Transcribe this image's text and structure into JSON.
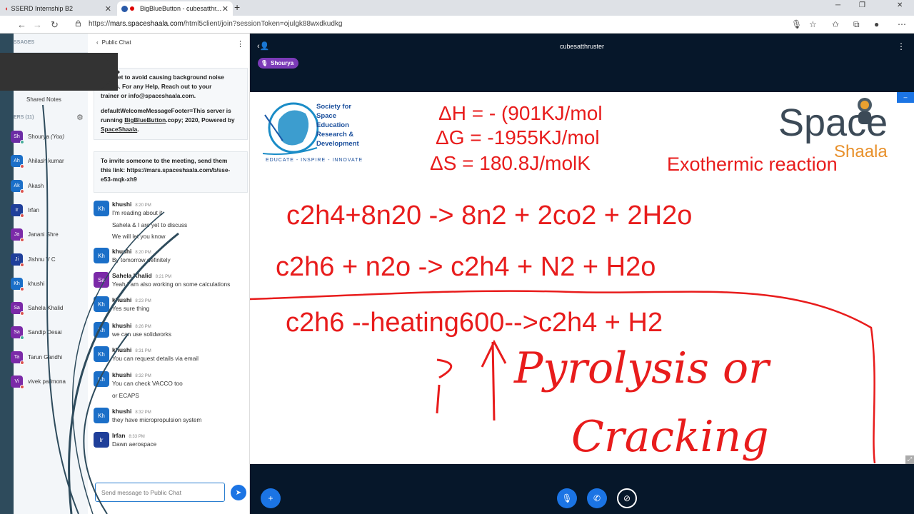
{
  "browser": {
    "tabs": [
      {
        "label": "SSERD Internship B2",
        "close": "✕"
      },
      {
        "label": "BigBlueButton - cubesatthr...",
        "close": "✕"
      }
    ],
    "new_tab": "+",
    "url_prefix": "https://",
    "url_domain": "mars.spaceshaala.com",
    "url_path": "/html5client/join?sessionToken=ojulgk88wxdkudkg"
  },
  "sidebar": {
    "messages_label": "SSAGES",
    "shared_notes": "Shared Notes",
    "users_label": "ERS (11)",
    "users": [
      {
        "initials": "Sh",
        "name": "Shourya",
        "suffix": "(You)",
        "color": "#6c2ca5",
        "status": "green"
      },
      {
        "initials": "Ah",
        "name": "Ahilash kumar",
        "color": "#1b6fc8",
        "status": "red"
      },
      {
        "initials": "Ak",
        "name": "Akash",
        "color": "#1b6fc8",
        "status": "red"
      },
      {
        "initials": "Ir",
        "name": "Irfan",
        "color": "#1f3f9a",
        "status": "red"
      },
      {
        "initials": "Ja",
        "name": "Janani Shre",
        "color": "#7b2aa8",
        "status": "red"
      },
      {
        "initials": "Ji",
        "name": "Jishnu V C",
        "color": "#1f3f9a",
        "status": "red"
      },
      {
        "initials": "Kh",
        "name": "khushi",
        "color": "#1b6fc8",
        "status": "red"
      },
      {
        "initials": "Sa",
        "name": "Sahela Khalid",
        "color": "#7b2aa8",
        "status": "red"
      },
      {
        "initials": "Sa",
        "name": "Sandip Desai",
        "color": "#7b2aa8",
        "status": "green"
      },
      {
        "initials": "Ta",
        "name": "Tarun Gandhi",
        "color": "#7b2aa8",
        "status": "red"
      },
      {
        "initials": "Vi",
        "name": "vivek pallmona",
        "color": "#7b2aa8",
        "status": "red"
      }
    ]
  },
  "chat": {
    "title": "Public Chat",
    "welcome": {
      "line1": "headset to avoid causing background noise",
      "line2": "others. For any Help, Reach out to your",
      "line3": "trainer or info@spaceshaala.com.",
      "footer1": "defaultWelcomeMessageFooter=This server is",
      "footer2a": "running ",
      "footer2_link": "BigBlueButton",
      "footer2b": ".copy; 2020, Powered by",
      "footer3_link": "SpaceShaala",
      "footer3b": "."
    },
    "invite": {
      "line1": "To invite someone to the meeting, send them",
      "line2": "this link: https://mars.spaceshaala.com/b/sse-",
      "line3": "e53-mqk-xh9"
    },
    "messages": [
      {
        "initials": "Kh",
        "color": "#1b6fc8",
        "name": "khushi",
        "time": "8:20 PM",
        "lines": [
          "I'm reading about it",
          "Sahela & I are yet to discuss",
          "We will let you know"
        ]
      },
      {
        "initials": "Kh",
        "color": "#1b6fc8",
        "name": "khushi",
        "time": "8:20 PM",
        "lines": [
          "By tomorrow definitely"
        ]
      },
      {
        "initials": "Sa",
        "color": "#7b2aa8",
        "name": "Sahela Khalid",
        "time": "8:21 PM",
        "lines": [
          "Yeah I am also working on some calculations"
        ]
      },
      {
        "initials": "Kh",
        "color": "#1b6fc8",
        "name": "khushi",
        "time": "8:23 PM",
        "lines": [
          "Yes sure thing"
        ]
      },
      {
        "initials": "Kh",
        "color": "#1b6fc8",
        "name": "khushi",
        "time": "8:26 PM",
        "lines": [
          "we can use solidworks"
        ]
      },
      {
        "initials": "Kh",
        "color": "#1b6fc8",
        "name": "khushi",
        "time": "8:31 PM",
        "lines": [
          "You can request details via email"
        ]
      },
      {
        "initials": "Kh",
        "color": "#1b6fc8",
        "name": "khushi",
        "time": "8:32 PM",
        "lines": [
          "You can check VACCO too",
          "or ECAPS"
        ]
      },
      {
        "initials": "Kh",
        "color": "#1b6fc8",
        "name": "khushi",
        "time": "8:32 PM",
        "lines": [
          "they have micropropulsion system"
        ]
      },
      {
        "initials": "Ir",
        "color": "#1f3f9a",
        "name": "Irfan",
        "time": "8:33 PM",
        "lines": [
          "Dawn aerospace"
        ]
      }
    ],
    "input_placeholder": "Send message to Public Chat"
  },
  "main": {
    "room_title": "cubesatthruster",
    "presenter": "Shourya",
    "slide": {
      "logo_lines": [
        "Society for",
        "Space",
        "Education",
        "Research &",
        "Development"
      ],
      "logo_tagline": "EDUCATE - INSPIRE - INNOVATE",
      "brand_top": "Space",
      "brand_bottom": "Shaala",
      "dh": "ΔH = - (901KJ/mol",
      "dg": "ΔG = -1955KJ/mol",
      "ds": "ΔS = 180.8J/molK",
      "exo": "Exothermic reaction",
      "eq1": "c2h4+8n20 -> 8n2 + 2co2 + 2H2o",
      "eq2": "c2h6 + n2o -> c2h4 + N2 + H2o",
      "eq3": "c2h6 --heating600-->c2h4  + H2",
      "hand1": "Pyrolysis or",
      "hand2": "Cracking"
    }
  },
  "colors": {
    "accent": "#1b74e4",
    "slide_red": "#e81c1c",
    "main_bg": "#06172a",
    "presenter": "#7c3bb8"
  }
}
